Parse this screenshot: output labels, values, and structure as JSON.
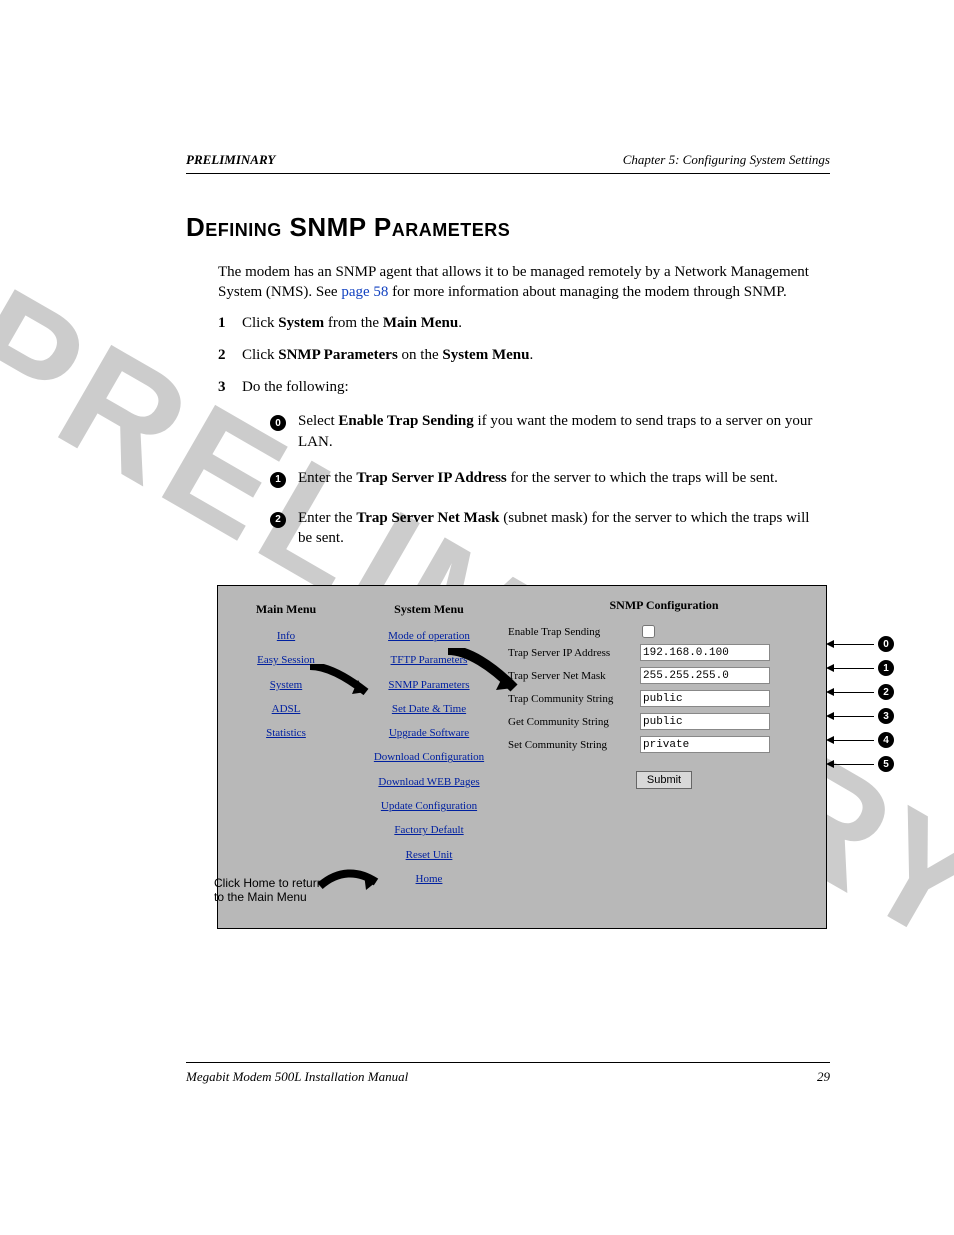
{
  "header": {
    "left": "PRELIMINARY",
    "right": "Chapter 5:  Configuring System Settings"
  },
  "watermark": "PRELIMINARY",
  "section_title": "Defining SNMP Parameters",
  "intro": {
    "pre": "The modem has an SNMP agent that allows it to be managed remotely by a Network Management System (NMS). See ",
    "link": "page 58",
    "post": " for more information about managing the modem through SNMP."
  },
  "steps": [
    {
      "num": "1",
      "pre": "Click ",
      "b1": "System",
      "mid": " from the ",
      "b2": "Main Menu",
      "post": "."
    },
    {
      "num": "2",
      "pre": "Click ",
      "b1": "SNMP Parameters",
      "mid": " on the ",
      "b2": "System Menu",
      "post": "."
    },
    {
      "num": "3",
      "pre": "Do the following:",
      "b1": "",
      "mid": "",
      "b2": "",
      "post": ""
    }
  ],
  "substeps": [
    {
      "sym": "0",
      "style": "filled",
      "pre": "Select ",
      "b": "Enable Trap Sending",
      "post": " if you want the modem to send traps to a server on your LAN."
    },
    {
      "sym": "1",
      "style": "filled",
      "pre": "Enter the ",
      "b": "Trap Server IP Address",
      "post": " for the server to which the traps will be sent."
    },
    {
      "sym": "2",
      "style": "filled",
      "pre": "Enter the ",
      "b": "Trap Server Net Mask",
      "post": " (subnet mask) for the server to which the traps will be sent."
    }
  ],
  "screenshot": {
    "main_menu": {
      "title": "Main Menu",
      "items": [
        "Info",
        "Easy Session",
        "System",
        "ADSL",
        "Statistics"
      ]
    },
    "system_menu": {
      "title": "System Menu",
      "items": [
        "Mode of operation",
        "TFTP Parameters",
        "SNMP Parameters",
        "Set Date & Time",
        "Upgrade Software",
        "Download Configuration",
        "Download WEB Pages",
        "Update Configuration",
        "Factory Default",
        "Reset Unit",
        "Home"
      ]
    },
    "snmp": {
      "title": "SNMP Configuration",
      "rows": [
        {
          "label": "Enable Trap Sending",
          "type": "checkbox",
          "value": ""
        },
        {
          "label": "Trap Server IP Address",
          "type": "text",
          "value": "192.168.0.100"
        },
        {
          "label": "Trap Server Net Mask",
          "type": "text",
          "value": "255.255.255.0"
        },
        {
          "label": "Trap Community String",
          "type": "text",
          "value": "public"
        },
        {
          "label": "Get Community String",
          "type": "text",
          "value": "public"
        },
        {
          "label": "Set Community String",
          "type": "text",
          "value": "private"
        }
      ],
      "submit": "Submit"
    },
    "home_note": "Click Home to return to the Main Menu",
    "callouts": [
      "0",
      "1",
      "2",
      "3",
      "4",
      "5"
    ]
  },
  "footer": {
    "left": "Megabit Modem 500L Installation Manual",
    "right": "29"
  }
}
